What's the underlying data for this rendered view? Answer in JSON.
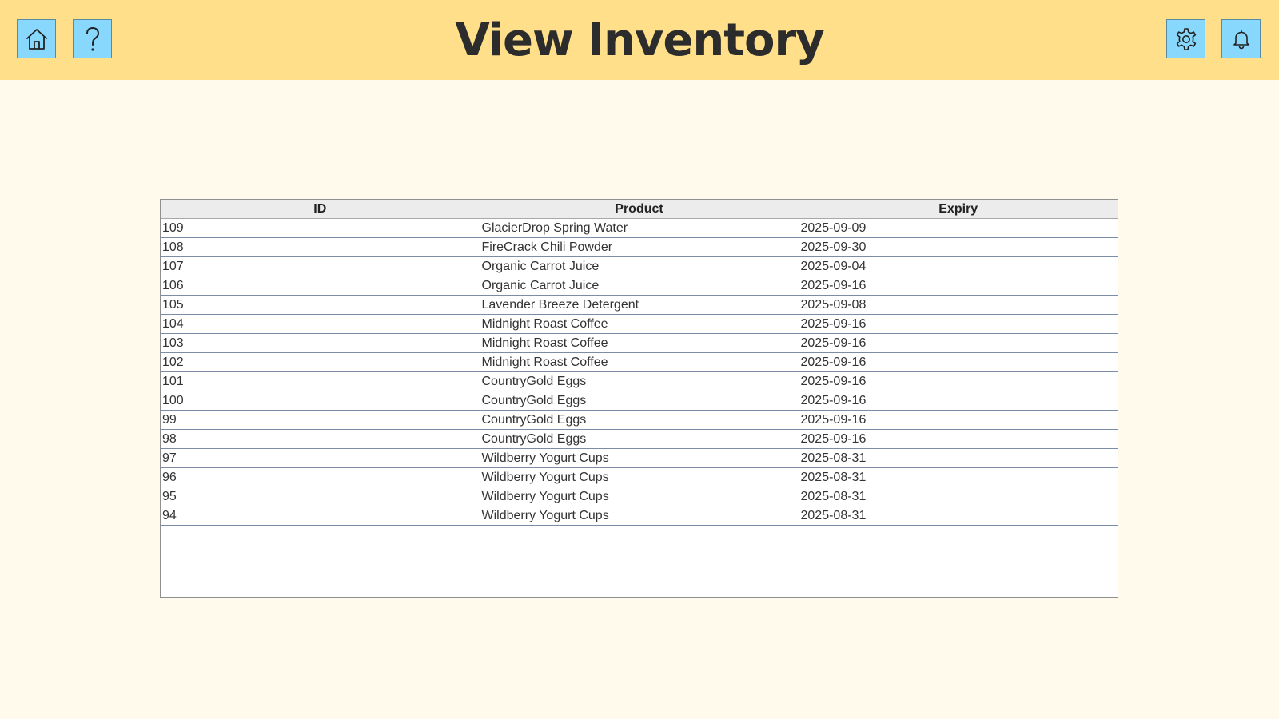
{
  "header": {
    "title": "View Inventory",
    "background": "#ffdf8a",
    "button_color": "#87d8fc",
    "left_buttons": [
      "home-icon",
      "help-icon"
    ],
    "right_buttons": [
      "gear-icon",
      "bell-icon"
    ]
  },
  "table": {
    "columns": [
      "ID",
      "Product",
      "Expiry"
    ],
    "rows": [
      [
        "109",
        "GlacierDrop Spring Water",
        "2025-09-09"
      ],
      [
        "108",
        "FireCrack Chili Powder",
        "2025-09-30"
      ],
      [
        "107",
        "Organic Carrot Juice",
        "2025-09-04"
      ],
      [
        "106",
        "Organic Carrot Juice",
        "2025-09-16"
      ],
      [
        "105",
        "Lavender Breeze Detergent",
        "2025-09-08"
      ],
      [
        "104",
        "Midnight Roast Coffee",
        "2025-09-16"
      ],
      [
        "103",
        "Midnight Roast Coffee",
        "2025-09-16"
      ],
      [
        "102",
        "Midnight Roast Coffee",
        "2025-09-16"
      ],
      [
        "101",
        "CountryGold Eggs",
        "2025-09-16"
      ],
      [
        "100",
        "CountryGold Eggs",
        "2025-09-16"
      ],
      [
        "99",
        "CountryGold Eggs",
        "2025-09-16"
      ],
      [
        "98",
        "CountryGold Eggs",
        "2025-09-16"
      ],
      [
        "97",
        "Wildberry Yogurt Cups",
        "2025-08-31"
      ],
      [
        "96",
        "Wildberry Yogurt Cups",
        "2025-08-31"
      ],
      [
        "95",
        "Wildberry Yogurt Cups",
        "2025-08-31"
      ],
      [
        "94",
        "Wildberry Yogurt Cups",
        "2025-08-31"
      ]
    ]
  }
}
